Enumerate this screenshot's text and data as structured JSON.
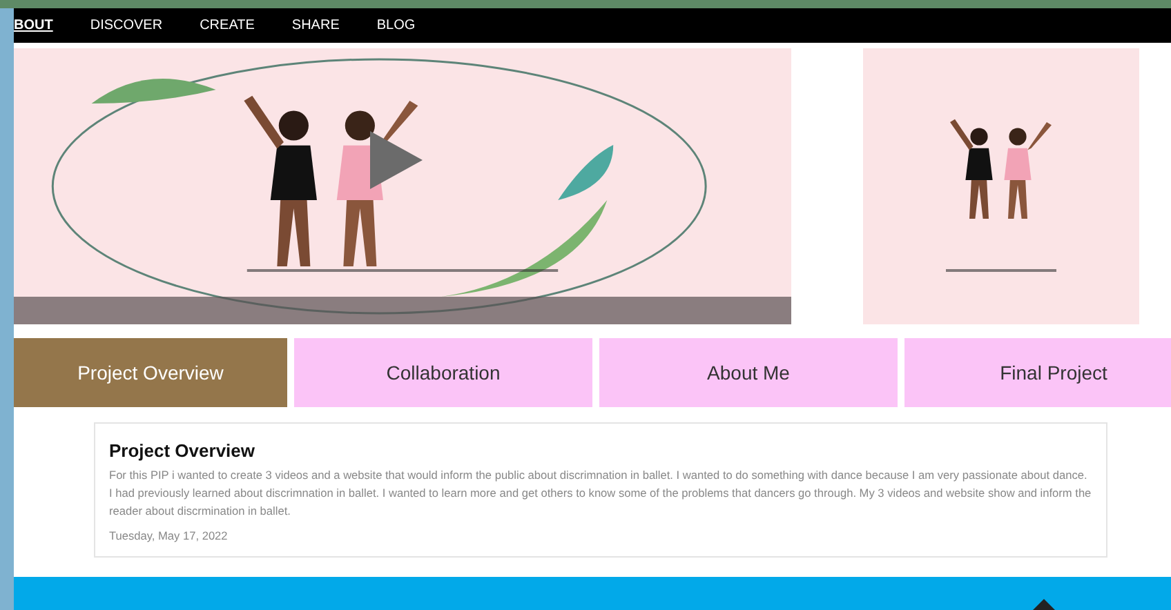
{
  "nav": [
    {
      "label": "BOUT",
      "selected": true
    },
    {
      "label": "DISCOVER",
      "selected": false
    },
    {
      "label": "CREATE",
      "selected": false
    },
    {
      "label": "SHARE",
      "selected": false
    },
    {
      "label": "BLOG",
      "selected": false
    }
  ],
  "tabs": [
    {
      "label": "Project Overview",
      "selected": true
    },
    {
      "label": "Collaboration",
      "selected": false
    },
    {
      "label": "About Me",
      "selected": false
    },
    {
      "label": "Final Project",
      "selected": false
    }
  ],
  "post": {
    "title": "Project Overview",
    "body": "For this PIP i wanted to create 3 videos and a website that would inform the public about discrimnation in ballet. I wanted to do something with dance because I am very passionate about dance. I had previously learned about discrimnation in ballet. I wanted to learn more and get others to know some of the problems that dancers go through. My 3 videos and website show and inform the reader about discrmination in ballet.",
    "date": "Tuesday, May 17, 2022"
  }
}
